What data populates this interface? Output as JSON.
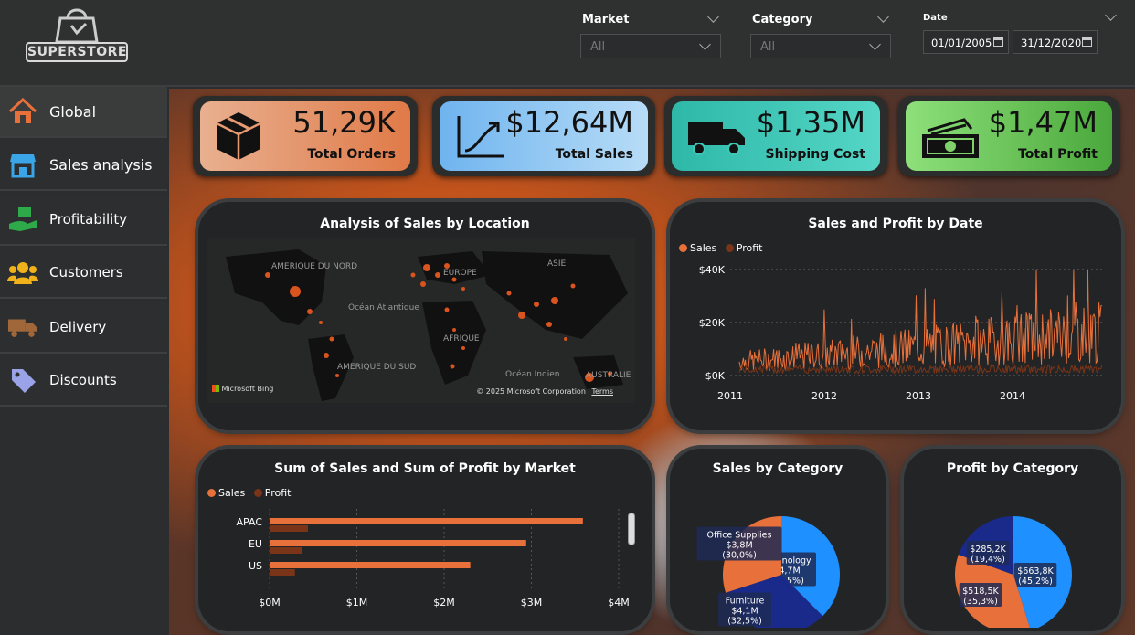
{
  "brand": {
    "logo_text": "SUPERSTORE"
  },
  "filters": {
    "market": {
      "label": "Market",
      "value": "All"
    },
    "category": {
      "label": "Category",
      "value": "All"
    },
    "date": {
      "label": "Date",
      "start": "01/01/2005",
      "end": "31/12/2020"
    }
  },
  "sidebar": {
    "items": [
      {
        "label": "Global",
        "icon": "home-icon",
        "active": true
      },
      {
        "label": "Sales analysis",
        "icon": "store-icon"
      },
      {
        "label": "Profitability",
        "icon": "money-hand-icon"
      },
      {
        "label": "Customers",
        "icon": "people-icon"
      },
      {
        "label": "Delivery",
        "icon": "truck-icon"
      },
      {
        "label": "Discounts",
        "icon": "tag-icon"
      }
    ]
  },
  "kpis": [
    {
      "value": "51,29K",
      "label": "Total Orders",
      "icon": "box-icon",
      "color": "#e89a72"
    },
    {
      "value": "$12,64M",
      "label": "Total Sales",
      "icon": "trend-icon",
      "color": "#8cc3f0"
    },
    {
      "value": "$1,35M",
      "label": "Shipping Cost",
      "icon": "truck-icon",
      "color": "#3ec8b8"
    },
    {
      "value": "$1,47M",
      "label": "Total Profit",
      "icon": "cash-icon",
      "color": "#7fd26a"
    }
  ],
  "map": {
    "title": "Analysis of Sales by Location",
    "labels": [
      "AMERIQUE DU NORD",
      "EUROPE",
      "ASIE",
      "Océan Atlantique",
      "AFRIQUE",
      "AMERIQUE DU SUD",
      "Océan Indien",
      "AUSTRALIE"
    ],
    "provider": "Microsoft Bing",
    "copyright": "© 2025 Microsoft Corporation",
    "terms": "Terms"
  },
  "colors": {
    "sales": "#e8703a",
    "profit": "#7a3418",
    "blue": "#1e90ff",
    "navy": "#1a2a8a"
  },
  "chart_data": [
    {
      "type": "line",
      "title": "Sales and Profit by Date",
      "series": [
        {
          "name": "Sales"
        },
        {
          "name": "Profit"
        }
      ],
      "x_ticks": [
        "2011",
        "2012",
        "2013",
        "2014"
      ],
      "y_ticks": [
        "$0K",
        "$20K",
        "$40K"
      ],
      "ylim": [
        0,
        40000
      ]
    },
    {
      "type": "bar",
      "title": "Sum of Sales and Sum of Profit by Market",
      "categories": [
        "APAC",
        "EU",
        "US"
      ],
      "series": [
        {
          "name": "Sales",
          "values": [
            3.59,
            2.94,
            2.3
          ]
        },
        {
          "name": "Profit",
          "values": [
            0.44,
            0.37,
            0.29
          ]
        }
      ],
      "x_ticks": [
        "$0M",
        "$1M",
        "$2M",
        "$3M",
        "$4M"
      ],
      "xlim": [
        0,
        4
      ]
    },
    {
      "type": "pie",
      "title": "Sales by Category",
      "slices": [
        {
          "label": "Technology",
          "value": 37.5,
          "text": "$4,7M (37,5%)",
          "color": "#1e90ff"
        },
        {
          "label": "Furniture",
          "value": 32.5,
          "text": "$4,1M (32,5%)",
          "color": "#1a2a8a"
        },
        {
          "label": "Office Supplies",
          "value": 30.0,
          "text": "$3,8M (30,0%)",
          "color": "#e8703a"
        }
      ]
    },
    {
      "type": "pie",
      "title": "Profit by Category",
      "slices": [
        {
          "label": "",
          "value": 45.2,
          "text": "$663,8K (45,2%)",
          "color": "#1e90ff"
        },
        {
          "label": "",
          "value": 35.3,
          "text": "$518,5K (35,3%)",
          "color": "#e8703a"
        },
        {
          "label": "",
          "value": 19.4,
          "text": "$285,2K (19,4%)",
          "color": "#1a2a8a"
        }
      ]
    }
  ]
}
